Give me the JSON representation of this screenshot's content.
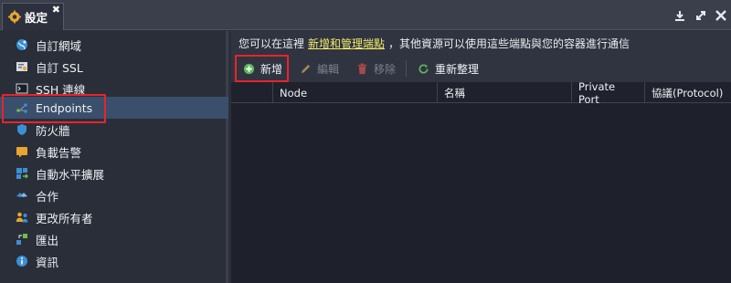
{
  "window": {
    "tab_title": "設定",
    "tab_close": "✖",
    "controls": [
      "download-icon",
      "expand-icon",
      "close-icon"
    ]
  },
  "sidebar": {
    "items": [
      {
        "label": "自訂網域",
        "icon": "globe-icon",
        "active": false
      },
      {
        "label": "自訂 SSL",
        "icon": "ssl-certificate-icon",
        "active": false
      },
      {
        "label": "SSH 連線",
        "icon": "terminal-icon",
        "active": false
      },
      {
        "label": "Endpoints",
        "icon": "endpoints-icon",
        "active": true
      },
      {
        "label": "防火牆",
        "icon": "shield-icon",
        "active": false
      },
      {
        "label": "負載告警",
        "icon": "alert-icon",
        "active": false
      },
      {
        "label": "自動水平擴展",
        "icon": "scaling-icon",
        "active": false
      },
      {
        "label": "合作",
        "icon": "collaboration-icon",
        "active": false
      },
      {
        "label": "更改所有者",
        "icon": "owner-change-icon",
        "active": false
      },
      {
        "label": "匯出",
        "icon": "export-icon",
        "active": false
      },
      {
        "label": "資訊",
        "icon": "info-icon",
        "active": false
      }
    ]
  },
  "info_bar": {
    "prefix": "您可以在這裡",
    "link": "新增和管理端點",
    "suffix": "，其他資源可以使用這些端點與您的容器進行通信"
  },
  "toolbar": {
    "add_label": "新增",
    "edit_label": "編輯",
    "remove_label": "移除",
    "refresh_label": "重新整理"
  },
  "grid": {
    "columns": [
      "Node",
      "名稱",
      "Private Port",
      "協議(Protocol)"
    ],
    "rows": []
  },
  "colors": {
    "accent_highlight": "#e8242a",
    "link": "#f2ea6b",
    "active_item": "#3a4f6b",
    "add_icon": "#5cb85c",
    "refresh_icon": "#5cb85c"
  }
}
